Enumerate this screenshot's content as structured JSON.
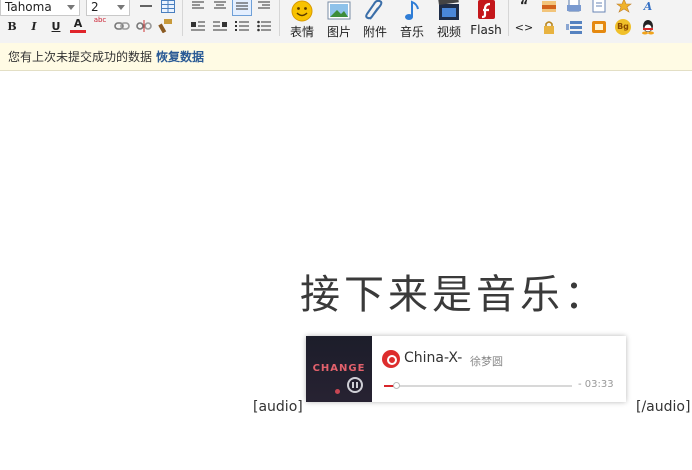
{
  "toolbar": {
    "font_family": "Tahoma",
    "font_size": "2",
    "format_icons": [
      "bold-icon",
      "italic-icon",
      "underline-icon",
      "font-color-icon",
      "spellcheck-icon",
      "link-icon",
      "unlink-icon",
      "format-painter-icon"
    ],
    "bold_glyph": "B",
    "italic_glyph": "I",
    "underline_glyph": "U",
    "font_color_glyph": "A",
    "spell_glyph": "abc",
    "buttons": [
      {
        "label": "表情",
        "icon": "smiley-icon"
      },
      {
        "label": "图片",
        "icon": "image-icon"
      },
      {
        "label": "附件",
        "icon": "paperclip-icon"
      },
      {
        "label": "音乐",
        "icon": "music-note-icon"
      },
      {
        "label": "视频",
        "icon": "film-icon"
      },
      {
        "label": "Flash",
        "icon": "flash-icon"
      }
    ],
    "quote_glyph": "“",
    "code_glyph": "<>",
    "bg_glyph": "Bg"
  },
  "notice": {
    "text": "您有上次未提交成功的数据",
    "link": "恢复数据"
  },
  "editor": {
    "heading": "接下来是音乐：",
    "audio_open": "[audio]",
    "audio_close": "[/audio]"
  },
  "player": {
    "cover_text": "CHANGE",
    "song": "China-X-",
    "artist": "徐梦圆",
    "progress": 0.06,
    "time": "- 03:33",
    "accent": "#dd2d2d"
  }
}
